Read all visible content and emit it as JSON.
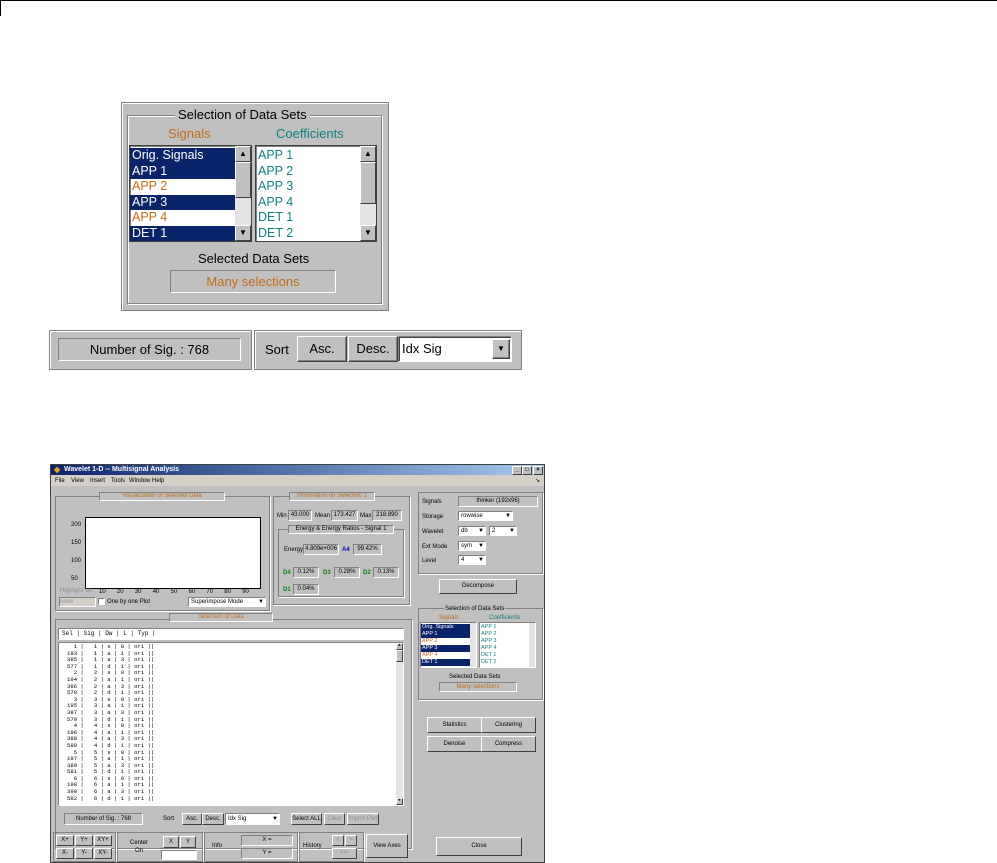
{
  "zoom": {
    "panel_title": "Selection of Data Sets",
    "signals_label": "Signals",
    "coefficients_label": "Coefficients",
    "signals_items": [
      {
        "label": "Orig. Signals",
        "selected": true
      },
      {
        "label": "APP 1",
        "selected": true
      },
      {
        "label": "APP 2",
        "selected": false
      },
      {
        "label": "APP 3",
        "selected": true
      },
      {
        "label": "APP 4",
        "selected": false
      },
      {
        "label": "DET 1",
        "selected": true
      }
    ],
    "coefficients_items": [
      "APP 1",
      "APP 2",
      "APP 3",
      "APP 4",
      "DET 1",
      "DET 2"
    ],
    "selected_data_sets_label": "Selected Data Sets",
    "selected_data_sets_value": "Many selections",
    "number_of_sig": "Number of Sig. : 768",
    "sort_label": "Sort",
    "asc_label": "Asc.",
    "desc_label": "Desc.",
    "sort_select_value": "Idx Sig"
  },
  "window": {
    "title": "Wavelet 1-D -- Multisignal Analysis",
    "menu": [
      "File",
      "View",
      "Insert",
      "Tools",
      "Window",
      "Help"
    ],
    "viz_title": "Visualization of Selected Data",
    "y_ticks": [
      "200",
      "150",
      "100",
      "50"
    ],
    "x_ticks": [
      "10",
      "20",
      "30",
      "40",
      "50",
      "60",
      "70",
      "80",
      "90"
    ],
    "highlight_label": "Highlight sel",
    "highlight_value": "none",
    "one_by_one": "One by one Plot",
    "superimpose": "Superimpose Mode",
    "info_title": "Information on Selection 1",
    "min_label": "Min",
    "min_value": "43.000",
    "mean_label": "Mean",
    "mean_value": "173.427",
    "max_label": "Max",
    "max_value": "218.890",
    "energy_title": "Energy & Energy Ratios - Signal 1",
    "energy_label": "Energy",
    "energy_value": "4.809e+006",
    "a4_label": "A4",
    "a4_value": "99.42%",
    "d4_label": "D4",
    "d4_value": "0.12%",
    "d3_label": "D3",
    "d3_value": "0.28%",
    "d2_label": "D2",
    "d2_value": "0.13%",
    "d1_label": "D1",
    "d1_value": "0.04%",
    "selection_title": "Selection of Data",
    "table_header": "Sel | Sig | Dw | L | Typ |",
    "table_rows": [
      "  1 |   1 | s | 0 | ori ||",
      "193 |   1 | a | 1 | ori ||",
      "385 |   1 | a | 3 | ori ||",
      "577 |   1 | d | 1 | ori ||",
      "  2 |   2 | s | 0 | ori ||",
      "194 |   2 | a | 1 | ori ||",
      "386 |   2 | a | 3 | ori ||",
      "578 |   2 | d | 1 | ori ||",
      "  3 |   3 | s | 0 | ori ||",
      "195 |   3 | a | 1 | ori ||",
      "387 |   3 | a | 3 | ori ||",
      "579 |   3 | d | 1 | ori ||",
      "  4 |   4 | s | 0 | ori ||",
      "196 |   4 | a | 1 | ori ||",
      "388 |   4 | a | 3 | ori ||",
      "580 |   4 | d | 1 | ori ||",
      "  5 |   5 | s | 0 | ori ||",
      "197 |   5 | a | 1 | ori ||",
      "389 |   5 | a | 3 | ori ||",
      "581 |   5 | d | 1 | ori ||",
      "  6 |   6 | s | 0 | ori ||",
      "198 |   6 | a | 1 | ori ||",
      "390 |   6 | a | 3 | ori ||",
      "582 |   6 | d | 1 | ori ||"
    ],
    "number_of_sig": "Number of Sig. : 768",
    "sort": "Sort",
    "asc": "Asc.",
    "desc": "Desc.",
    "sort_value": "Idx Sig",
    "select_all": "Select ALL",
    "clear": "Clear",
    "import_part": "Import Part",
    "signals_label": "Signals",
    "signals_value": "thinker (192x96)",
    "storage_label": "Storage",
    "storage_value": "rowwise",
    "wavelet_label": "Wavelet",
    "wavelet_family": "db",
    "wavelet_num": "2",
    "extmode_label": "Ext Mode",
    "extmode_value": "sym",
    "level_label": "Level",
    "level_value": "4",
    "decompose": "Decompose",
    "sel_ds_title": "Selection of Data Sets",
    "sig_label": "Signals",
    "coef_label": "Coefficients",
    "sig_items": [
      "Orig. Signals",
      "APP 1",
      "APP 2",
      "APP 3",
      "APP 4",
      "DET 1"
    ],
    "coef_items": [
      "APP 1",
      "APP 2",
      "APP 3",
      "APP 4",
      "DET 1",
      "DET 2"
    ],
    "selected_ds": "Selected Data Sets",
    "many": "Many selections",
    "statistics": "Statistics",
    "clustering": "Clustering",
    "denoise": "Denoise",
    "compress": "Compress",
    "xp": "X+",
    "yp": "Y+",
    "xyp": "XY+",
    "xm": "X-",
    "ym": "Y-",
    "xym": "XY-",
    "center_on": "Center On",
    "x_btn": "X",
    "y_btn": "Y",
    "info": "Info",
    "x_eq": "X =",
    "y_eq": "Y =",
    "history": "History",
    "view_axes": "View Axes",
    "close": "Close"
  }
}
